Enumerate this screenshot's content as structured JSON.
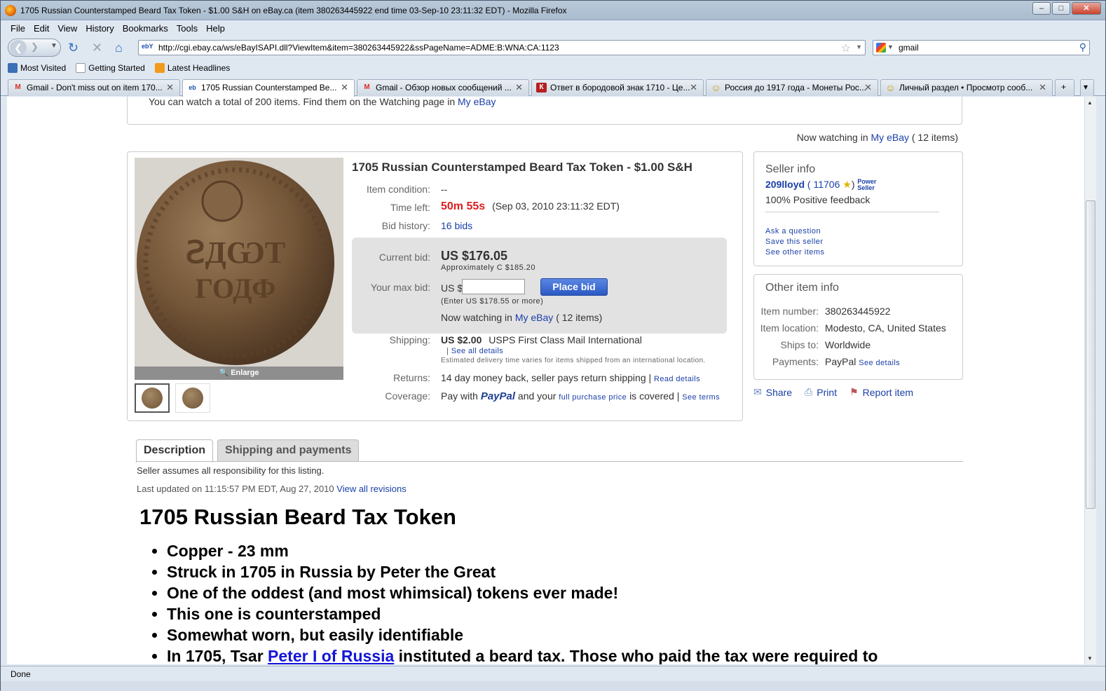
{
  "window": {
    "title": "1705 Russian Counterstamped Beard Tax Token - $1.00 S&H on eBay.ca (item 380263445922 end time 03-Sep-10 23:11:32 EDT) - Mozilla Firefox",
    "min": "–",
    "max": "□",
    "close": "✕"
  },
  "menu": [
    "File",
    "Edit",
    "View",
    "History",
    "Bookmarks",
    "Tools",
    "Help"
  ],
  "nav": {
    "url": "http://cgi.ebay.ca/ws/eBayISAPI.dll?ViewItem&item=380263445922&ssPageName=ADME:B:WNA:CA:1123",
    "url_favicon": "ebY",
    "search_value": "gmail"
  },
  "bookmarks": [
    "Most Visited",
    "Getting Started",
    "Latest Headlines"
  ],
  "tabs": [
    {
      "label": "Gmail - Don't miss out on item 170...",
      "icon": "M"
    },
    {
      "label": "1705 Russian Counterstamped Be...",
      "icon": "eb"
    },
    {
      "label": "Gmail - Обзор новых сообщений ...",
      "icon": "M"
    },
    {
      "label": "Ответ в бородовой знак 1710 - Це...",
      "icon": "К"
    },
    {
      "label": "Россия до 1917 года - Монеты Рос...",
      "icon": "☺"
    },
    {
      "label": "Личный раздел • Просмотр сооб...",
      "icon": "☺"
    }
  ],
  "page": {
    "watch_notice": "You can watch a total of 200 items. Find them on the Watching page in",
    "watch_link": "My eBay",
    "now_watching_prefix": "Now watching in",
    "now_watching_link": "My eBay",
    "now_watching_suffix": "( 12 items)",
    "item": {
      "title": "1705 Russian Counterstamped Beard Tax Token - $1.00 S&H",
      "enlarge": "Enlarge",
      "condition_label": "Item condition:",
      "condition_value": "--",
      "time_label": "Time left:",
      "time_value": "50m 55s",
      "time_end": "(Sep 03, 2010 23:11:32 EDT)",
      "bids_label": "Bid history:",
      "bids_value": "16 bids",
      "current_label": "Current bid:",
      "current_value": "US $176.05",
      "approx": "Approximately C $185.20",
      "max_label": "Your max bid:",
      "max_currency": "US $",
      "place_bid": "Place bid",
      "enter_note": "(Enter US $178.55 or more)",
      "watch_prefix": "Now watching in",
      "watch_link": "My eBay",
      "watch_suffix": "( 12 items)",
      "shipping_label": "Shipping:",
      "shipping_price": "US $2.00",
      "shipping_service": "USPS First Class Mail International",
      "shipping_link": "See all details",
      "shipping_note": "Estimated delivery time varies for items shipped from an international location.",
      "returns_label": "Returns:",
      "returns_value": "14 day money back, seller pays return shipping |",
      "returns_link": "Read details",
      "coverage_label": "Coverage:",
      "coverage_pre": "Pay with",
      "coverage_paypal": "PayPal",
      "coverage_mid": "and your",
      "coverage_link": "full purchase price",
      "coverage_post": "is covered |",
      "coverage_terms": "See terms"
    },
    "seller": {
      "heading": "Seller info",
      "name": "209lloyd",
      "feedback_score": "( 11706",
      "close_paren": ")",
      "power_seller": "Power Seller",
      "positive": "100% Positive feedback",
      "links": [
        "Ask a question",
        "Save this seller",
        "See other items"
      ]
    },
    "other": {
      "heading": "Other item info",
      "rows": [
        {
          "label": "Item number:",
          "value": "380263445922"
        },
        {
          "label": "Item location:",
          "value": "Modesto, CA, United States"
        },
        {
          "label": "Ships to:",
          "value": "Worldwide"
        },
        {
          "label": "Payments:",
          "value": "PayPal"
        }
      ],
      "payments_link": "See details"
    },
    "actions": [
      "Share",
      "Print",
      "Report item"
    ],
    "desc_tabs": [
      "Description",
      "Shipping and payments"
    ],
    "desc_note": "Seller assumes all responsibility for this listing.",
    "desc_updated": "Last updated on 11:15:57 PM EDT, Aug 27, 2010",
    "desc_revisions": "View all revisions",
    "desc_heading": "1705 Russian Beard Tax Token",
    "desc_items": [
      "Copper - 23 mm",
      "Struck in 1705 in Russia by Peter the Great",
      "One of the oddest (and most whimsical) tokens ever made!",
      "This one is counterstamped",
      "Somewhat worn, but easily identifiable"
    ],
    "desc_last_pre": "In 1705, Tsar",
    "desc_last_link": "Peter I of Russia",
    "desc_last_post": "instituted a beard tax. Those who paid the tax were required to"
  },
  "status": "Done"
}
